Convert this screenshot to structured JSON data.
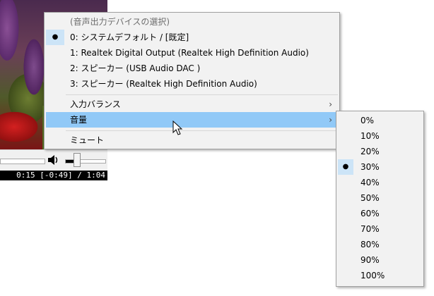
{
  "player": {
    "time_display": "0:15 [-0:49] / 1:04"
  },
  "main_menu": {
    "items": [
      {
        "label": "(音声出力デバイスの選択)",
        "disabled": true,
        "checked": false
      },
      {
        "label": "0: システムデフォルト / [既定]",
        "disabled": false,
        "checked": true
      },
      {
        "label": "1: Realtek Digital Output (Realtek High Definition Audio)",
        "disabled": false,
        "checked": false
      },
      {
        "label": "2: スピーカー (USB Audio DAC   )",
        "disabled": false,
        "checked": false
      },
      {
        "label": "3: スピーカー (Realtek High Definition Audio)",
        "disabled": false,
        "checked": false
      },
      {
        "label": "入力バランス",
        "submenu": true
      },
      {
        "label": "音量",
        "submenu": true,
        "highlighted": true
      },
      {
        "label": "ミュート"
      }
    ]
  },
  "volume_submenu": {
    "selected": "30%",
    "items": [
      "0%",
      "10%",
      "20%",
      "30%",
      "40%",
      "50%",
      "60%",
      "70%",
      "80%",
      "90%",
      "100%"
    ]
  },
  "colors": {
    "highlight": "#91c9f7",
    "check_bg": "#cce4f7",
    "menu_bg": "#f2f2f2"
  },
  "icons": {
    "bullet": "●",
    "submenu_arrow": "›"
  },
  "volume_level": 0.3
}
